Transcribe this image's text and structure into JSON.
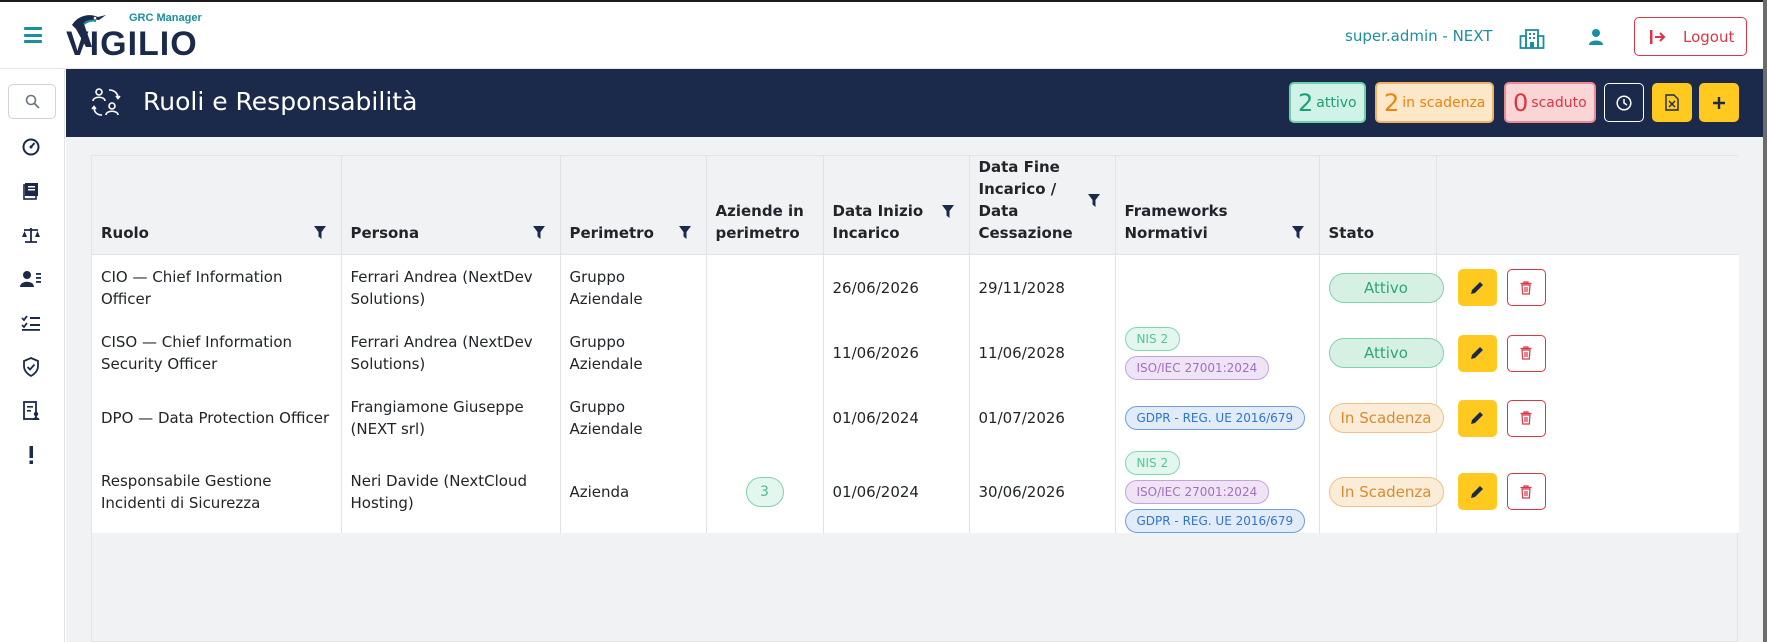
{
  "app": {
    "logo_sub": "GRC Manager",
    "logo_word": "VIGILIO",
    "user_label": "super.admin - NEXT",
    "logout_label": "Logout"
  },
  "sidebar": {
    "search_icon": "search-icon",
    "items": [
      {
        "icon": "gauge-icon"
      },
      {
        "icon": "book-icon"
      },
      {
        "icon": "scale-icon"
      },
      {
        "icon": "users-list-icon"
      },
      {
        "icon": "checklist-icon"
      },
      {
        "icon": "shield-check-icon"
      },
      {
        "icon": "document-user-icon"
      },
      {
        "icon": "exclamation-icon"
      }
    ]
  },
  "header": {
    "title": "Ruoli e Responsabilità",
    "counters": {
      "active": {
        "num": "2",
        "label": "attivo"
      },
      "expiring": {
        "num": "2",
        "label": "in scadenza"
      },
      "expired": {
        "num": "0",
        "label": "scaduto"
      }
    }
  },
  "table": {
    "columns": [
      "Ruolo",
      "Persona",
      "Perimetro",
      "Aziende in perimetro",
      "Data Inizio Incarico",
      "Data Fine Incarico / Data Cessazione",
      "Frameworks Normativi",
      "Stato",
      ""
    ],
    "rows": [
      {
        "ruolo": "CIO — Chief Information Officer",
        "persona": "Ferrari Andrea (NextDev Solutions)",
        "perimetro": "Gruppo Aziendale",
        "aziende": "",
        "inizio": "26/06/2026",
        "fine": "29/11/2028",
        "frameworks": [],
        "stato": "Attivo"
      },
      {
        "ruolo": "CISO — Chief Information Security Officer",
        "persona": "Ferrari Andrea (NextDev Solutions)",
        "perimetro": "Gruppo Aziendale",
        "aziende": "",
        "inizio": "11/06/2026",
        "fine": "11/06/2028",
        "frameworks": [
          "NIS 2",
          "ISO/IEC 27001:2024"
        ],
        "stato": "Attivo"
      },
      {
        "ruolo": "DPO — Data Protection Officer",
        "persona": "Frangiamone Giuseppe (NEXT srl)",
        "perimetro": "Gruppo Aziendale",
        "aziende": "",
        "inizio": "01/06/2024",
        "fine": "01/07/2026",
        "frameworks": [
          "GDPR - REG. UE 2016/679"
        ],
        "stato": "In Scadenza"
      },
      {
        "ruolo": "Responsabile Gestione Incidenti di Sicurezza",
        "persona": "Neri Davide (NextCloud Hosting)",
        "perimetro": "Azienda",
        "aziende": "3",
        "inizio": "01/06/2024",
        "fine": "30/06/2026",
        "frameworks": [
          "NIS 2",
          "ISO/IEC 27001:2024",
          "GDPR - REG. UE 2016/679"
        ],
        "stato": "In Scadenza"
      }
    ]
  },
  "colors": {
    "brand_navy": "#1b2a4a",
    "brand_teal": "#1a8f9e",
    "accent_yellow": "#ffc91f",
    "danger": "#dc3545"
  }
}
